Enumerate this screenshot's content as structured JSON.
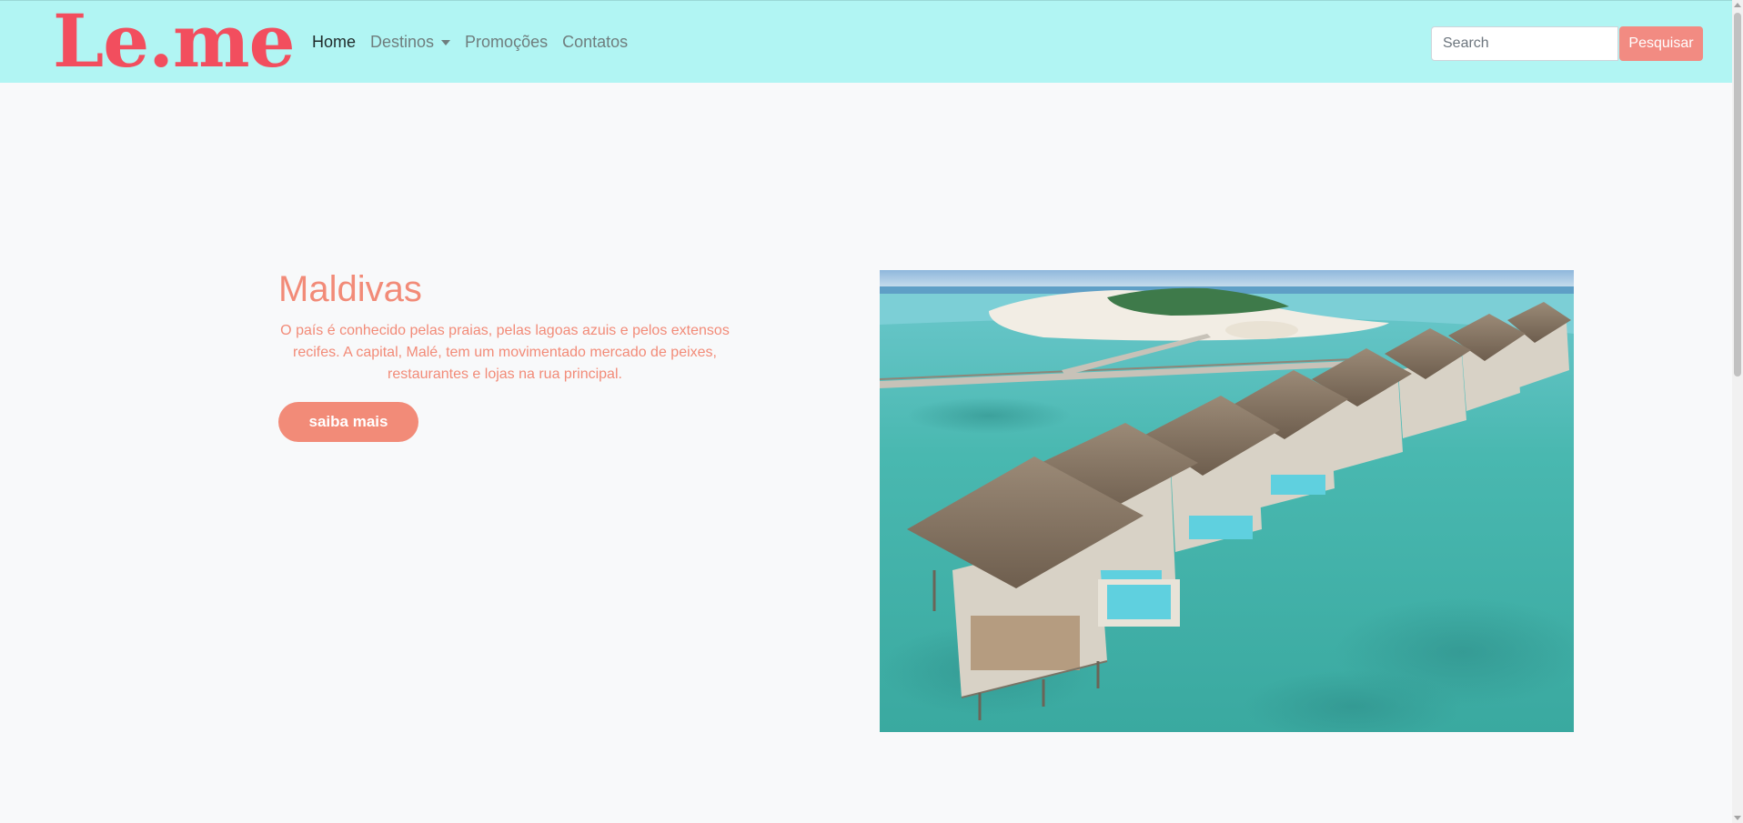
{
  "navbar": {
    "brand": "Le.me",
    "links": [
      {
        "label": "Home",
        "active": true
      },
      {
        "label": "Destinos",
        "dropdown": true
      },
      {
        "label": "Promoções"
      },
      {
        "label": "Contatos"
      }
    ],
    "search": {
      "placeholder": "Search",
      "value": "",
      "button_label": "Pesquisar"
    }
  },
  "hero": {
    "title": "Maldivas",
    "description": "O país é conhecido pelas praias, pelas lagoas azuis e pelos extensos recifes. A capital, Malé, tem um movimentado mercado de peixes, restaurantes e lojas na rua principal.",
    "button_label": "saiba mais"
  },
  "colors": {
    "navbar_bg": "#b1f5f3",
    "brand": "#f24e5e",
    "accent": "#f28b78",
    "page_bg": "#f8f9fa"
  },
  "icons": {
    "dropdown": "caret-down-icon"
  }
}
